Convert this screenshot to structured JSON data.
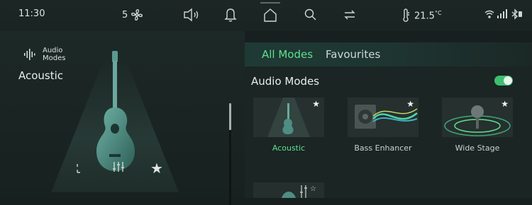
{
  "status_bar": {
    "time": "11:30",
    "fan_speed": "5",
    "temperature": "21.5",
    "temperature_unit": "°C"
  },
  "left_panel": {
    "app_label": "Audio Modes",
    "current_mode": "Acoustic"
  },
  "right_panel": {
    "tabs": [
      {
        "label": "All Modes",
        "active": true
      },
      {
        "label": "Favourites",
        "active": false
      }
    ],
    "section_title": "Audio Modes",
    "toggle_on": true,
    "modes": [
      {
        "label": "Acoustic",
        "active": true,
        "favourite": true
      },
      {
        "label": "Bass Enhancer",
        "active": false,
        "favourite": true
      },
      {
        "label": "Wide Stage",
        "active": false,
        "favourite": true
      }
    ]
  },
  "colors": {
    "accent_green": "#5fe08e",
    "toggle_green": "#3dbf6e"
  }
}
